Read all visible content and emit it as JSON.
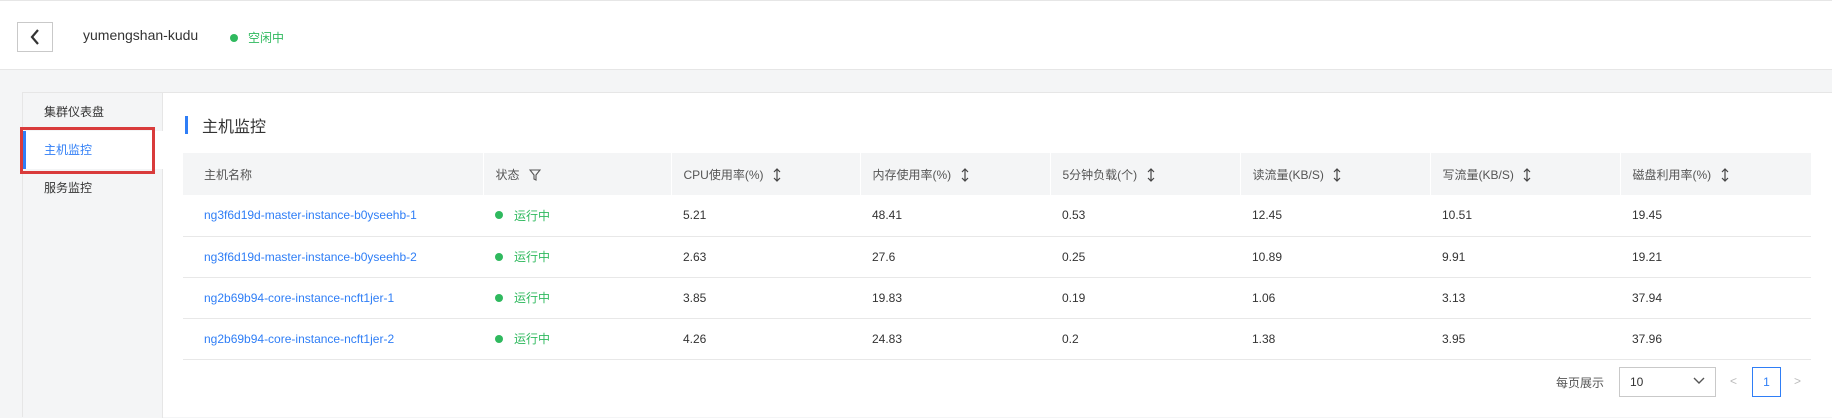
{
  "header": {
    "cluster_name": "yumengshan-kudu",
    "status": "空闲中",
    "status_color": "#2fb95e"
  },
  "sidebar": {
    "items": [
      {
        "label": "集群仪表盘",
        "active": false
      },
      {
        "label": "主机监控",
        "active": true
      },
      {
        "label": "服务监控",
        "active": false
      }
    ]
  },
  "section": {
    "title": "主机监控"
  },
  "table": {
    "columns": [
      "主机名称",
      "状态",
      "CPU使用率(%)",
      "内存使用率(%)",
      "5分钟负载(个)",
      "读流量(KB/S)",
      "写流量(KB/S)",
      "磁盘利用率(%)"
    ],
    "rows": [
      {
        "host": "ng3f6d19d-master-instance-b0yseehb-1",
        "status": "运行中",
        "cpu": "5.21",
        "mem": "48.41",
        "load": "0.53",
        "read": "12.45",
        "write": "10.51",
        "disk": "19.45"
      },
      {
        "host": "ng3f6d19d-master-instance-b0yseehb-2",
        "status": "运行中",
        "cpu": "2.63",
        "mem": "27.6",
        "load": "0.25",
        "read": "10.89",
        "write": "9.91",
        "disk": "19.21"
      },
      {
        "host": "ng2b69b94-core-instance-ncft1jer-1",
        "status": "运行中",
        "cpu": "3.85",
        "mem": "19.83",
        "load": "0.19",
        "read": "1.06",
        "write": "3.13",
        "disk": "37.94"
      },
      {
        "host": "ng2b69b94-core-instance-ncft1jer-2",
        "status": "运行中",
        "cpu": "4.26",
        "mem": "24.83",
        "load": "0.2",
        "read": "1.38",
        "write": "3.95",
        "disk": "37.96"
      }
    ]
  },
  "pagination": {
    "per_page_label": "每页展示",
    "per_page_value": "10",
    "prev": "<",
    "current_page": "1",
    "next": ">"
  },
  "colors": {
    "accent": "#2f7ef6",
    "running": "#2fb95e",
    "highlight": "#d93b3b"
  }
}
